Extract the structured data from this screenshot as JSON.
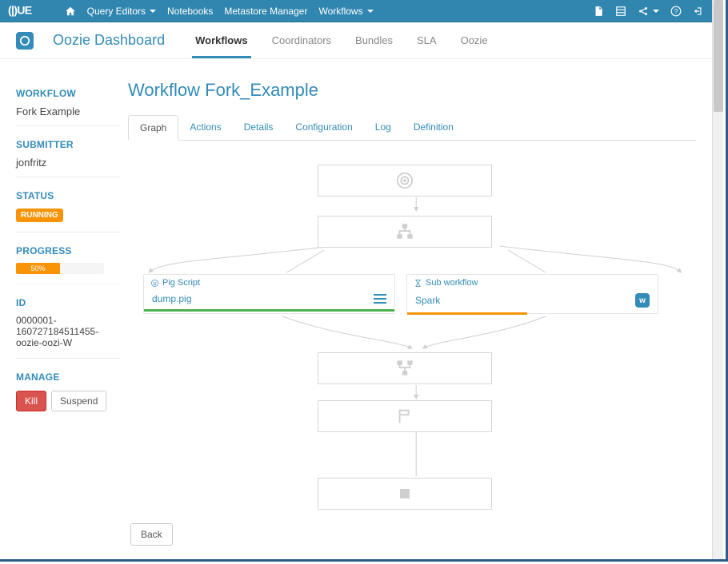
{
  "nav": {
    "query_editors": "Query Editors",
    "notebooks": "Notebooks",
    "metastore": "Metastore Manager",
    "workflows": "Workflows"
  },
  "subnav": {
    "title": "Oozie Dashboard",
    "tabs": [
      "Workflows",
      "Coordinators",
      "Bundles",
      "SLA",
      "Oozie"
    ]
  },
  "sidebar": {
    "workflow": {
      "h": "WORKFLOW",
      "v": "Fork Example"
    },
    "submitter": {
      "h": "SUBMITTER",
      "v": "jonfritz"
    },
    "status": {
      "h": "STATUS",
      "v": "RUNNING"
    },
    "progress": {
      "h": "PROGRESS",
      "v": "50%",
      "percent": 50
    },
    "id": {
      "h": "ID",
      "v": "0000001-160727184511455-oozie-oozi-W"
    },
    "manage": {
      "h": "MANAGE",
      "kill": "Kill",
      "suspend": "Suspend"
    }
  },
  "content": {
    "title": "Workflow Fork_Example",
    "tabs": [
      "Graph",
      "Actions",
      "Details",
      "Configuration",
      "Log",
      "Definition"
    ],
    "back": "Back"
  },
  "graph": {
    "cards": [
      {
        "title": "Pig Script",
        "name": "dump.pig",
        "status_color": "#4caf50"
      },
      {
        "title": "Sub workflow",
        "name": "Spark",
        "badge": "w",
        "status_color": "#f89406",
        "progress_fraction": 0.48
      }
    ],
    "nodes": [
      "start",
      "fork",
      "join",
      "end",
      "kill"
    ]
  }
}
